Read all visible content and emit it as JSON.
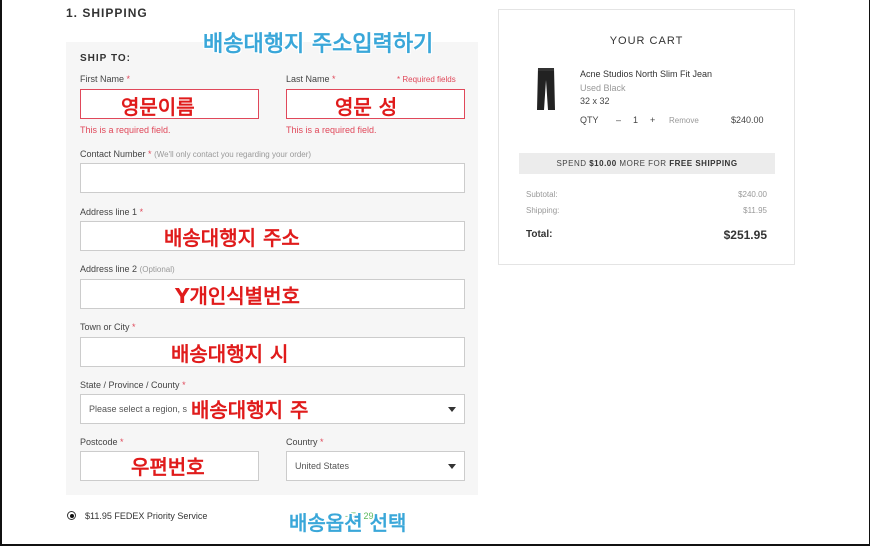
{
  "section": {
    "title": "1. SHIPPING"
  },
  "form": {
    "ship_to": "SHIP TO:",
    "required_note": "* Required fields",
    "first_name": {
      "label": "First Name",
      "req": "*",
      "error": "This is a required field."
    },
    "last_name": {
      "label": "Last Name",
      "req": "*",
      "error": "This is a required field."
    },
    "contact": {
      "label": "Contact Number",
      "req": "*",
      "note": "(We'll only contact you regarding your order)"
    },
    "address1": {
      "label": "Address line 1",
      "req": "*"
    },
    "address2": {
      "label": "Address line 2",
      "note": "(Optional)"
    },
    "city": {
      "label": "Town or City",
      "req": "*"
    },
    "state": {
      "label": "State / Province / County",
      "req": "*",
      "placeholder": "Please select a region, s"
    },
    "postcode": {
      "label": "Postcode",
      "req": "*"
    },
    "country": {
      "label": "Country",
      "req": "*",
      "value": "United States"
    }
  },
  "shipping_option": {
    "label": "$11.95 FEDEX Priority Service",
    "date": "- Fri 29"
  },
  "annotations": {
    "title": "배송대행지 주소입력하기",
    "first_name": "영문이름",
    "last_name": "영문 성",
    "address1": "배송대행지 주소",
    "address2": "Y개인식별번호",
    "city": "배송대행지 시",
    "state": "배송대행지 주",
    "postcode": "우편번호",
    "shipping": "배송옵션 선택"
  },
  "cart": {
    "title": "YOUR CART",
    "product": {
      "name": "Acne Studios North Slim Fit Jean",
      "color": "Used Black",
      "size": "32 x 32",
      "qty_label": "QTY",
      "minus": "–",
      "qty": "1",
      "plus": "+",
      "remove": "Remove",
      "price": "$240.00"
    },
    "banner_prefix": "SPEND ",
    "banner_amount": "$10.00",
    "banner_mid": " MORE FOR ",
    "banner_bold": "FREE SHIPPING",
    "subtotal_label": "Subtotal:",
    "subtotal": "$240.00",
    "shipping_label": "Shipping:",
    "shipping": "$11.95",
    "total_label": "Total:",
    "total": "$251.95"
  },
  "colors": {
    "error": "#e0485a",
    "annotation_red": "#e01b1b",
    "annotation_blue": "#3aa7d9",
    "date_green": "#5cb85c"
  }
}
